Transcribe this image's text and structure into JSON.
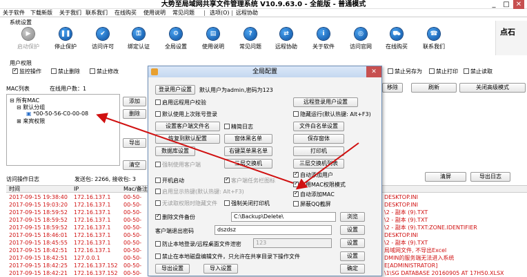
{
  "window": {
    "title": "大势至局域网共享文件管理系统 V10.9.63.0 - 全能版 - 普通模式",
    "controls": [
      "_",
      "□",
      "✕"
    ]
  },
  "menu": [
    "关于软件",
    "下载新版",
    "关于我们",
    "联系我们",
    "在线购买",
    "使用说明",
    "常见问题",
    "选项(O)",
    "远程协助"
  ],
  "sys_group": "系统设置",
  "toolbar": [
    {
      "label": "启动保护",
      "icon": "play-icon",
      "glyph": "▶",
      "disabled": true
    },
    {
      "label": "停止保护",
      "icon": "pause-icon",
      "glyph": "❚❚"
    },
    {
      "label": "访问许可",
      "icon": "access-icon",
      "glyph": "✔"
    },
    {
      "label": "绑定认证",
      "icon": "bind-icon",
      "glyph": "⚿"
    },
    {
      "label": "全局设置",
      "icon": "gear-icon",
      "glyph": "⚙"
    },
    {
      "label": "使用说明",
      "icon": "book-icon",
      "glyph": "▤"
    },
    {
      "label": "常见问题",
      "icon": "question-icon",
      "glyph": "?"
    },
    {
      "label": "远程协助",
      "icon": "remote-icon",
      "glyph": "⇄"
    },
    {
      "label": "关于软件",
      "icon": "info-icon",
      "glyph": "i"
    },
    {
      "label": "访问官网",
      "icon": "globe-icon",
      "glyph": "◎"
    },
    {
      "label": "在线购买",
      "icon": "cart-icon",
      "glyph": "⛟"
    },
    {
      "label": "联系我们",
      "icon": "contact-icon",
      "glyph": "☎"
    }
  ],
  "logo_text": "点石",
  "perm_group": "用户权限",
  "perms": [
    {
      "label": "监控操作",
      "checked": true
    },
    {
      "label": "禁止删除",
      "checked": false
    },
    {
      "label": "禁止修改",
      "checked": false
    },
    {
      "label": "禁止另存为",
      "checked": false
    },
    {
      "label": "禁止打印",
      "checked": false
    },
    {
      "label": "禁止读取",
      "checked": false
    }
  ],
  "mac_list_label": "MAC列表",
  "online_users": "在线用户数：1",
  "tree": {
    "root": "所有MAC",
    "group": "默认分组",
    "mac": "*00-50-56-C0-00-08",
    "extra": "来宾权限"
  },
  "left_buttons": [
    "添加",
    "删除",
    "导出",
    "清空"
  ],
  "right_buttons": [
    "移除",
    "刷新",
    "关闭高级模式"
  ],
  "log": {
    "title": "访问操作日志",
    "stats": "发送包: 2266, 接收包: 3",
    "clear": "清屏",
    "export": "导出日志",
    "headers": [
      "时间",
      "IP",
      "Mac/备注"
    ],
    "rows": [
      {
        "time": "2017-09-15 19:38:40",
        "ip": "172.16.137.1",
        "mac": "00-50-",
        "tail": "DESKTOP.INI"
      },
      {
        "time": "2017-09-15 19:03:20",
        "ip": "172.16.137.1",
        "mac": "00-50-",
        "tail": "DESKTOP.INI"
      },
      {
        "time": "2017-09-15 18:59:52",
        "ip": "172.16.137.1",
        "mac": "00-50-",
        "tail": "\\2 - 副本 (9).TXT"
      },
      {
        "time": "2017-09-15 18:59:52",
        "ip": "172.16.137.1",
        "mac": "00-50-",
        "tail": "\\2 - 副本 (9).TXT"
      },
      {
        "time": "2017-09-15 18:59:52",
        "ip": "172.16.137.1",
        "mac": "00-50-",
        "tail": "\\2 - 副本 (9).TXT:ZONE.IDENTIFIER"
      },
      {
        "time": "2017-09-15 18:46:01",
        "ip": "172.16.137.1",
        "mac": "00-50-",
        "tail": "DESKTOP.INI"
      },
      {
        "time": "2017-09-15 18:45:55",
        "ip": "172.16.137.1",
        "mac": "00-50-",
        "tail": "\\2 - 副本 (9).TXT"
      },
      {
        "time": "2017-09-15 18:42:51",
        "ip": "172.16.137.1",
        "mac": "00-50-",
        "tail": "局域网文件, 不导出Excel"
      },
      {
        "time": "2017-09-15 18:42:51",
        "ip": "127.0.0.1",
        "mac": "00-50-",
        "tail": "DMIN的服务端无法进入系统"
      },
      {
        "time": "2017-09-15 18:42:25",
        "ip": "172.16.137.152",
        "mac": "00-50-",
        "tail": "E[ADMINISTRATOR]"
      },
      {
        "time": "2017-09-15 18:42:21",
        "ip": "172.16.137.152",
        "mac": "00-50-",
        "tail": "\\1\\SG DATABASE 20160905 AT 17H50.XLSX"
      }
    ]
  },
  "dialog": {
    "title": "全局配置",
    "login_btn": "登录用户设置",
    "login_info": "默认用户为admin,密码为123",
    "remote_login_btn": "远程登录用户设置",
    "remote_verify": "启用远程用户校验",
    "hide_run": "隐藏运行(默认热键: Alt+F3)",
    "default_user": "默认使用上次账号登录",
    "client_file": "设置客户端文件名",
    "precise_log": "精简日志",
    "file_whitelist": "文件白名单设置",
    "restore_default": "恢复到默认配置",
    "window_blacklist": "窗体黑名单",
    "save_window": "保存窗体",
    "database_settings": "数据库设置",
    "right_menu_blacklist": "右键菜单黑名单",
    "printer": "打印机",
    "force_client": "强制使用客户端",
    "l3_switch": "三层交换机",
    "l3_switch_list": "三层交换机列表",
    "auto_add_user": "自动添加用户",
    "enable_mac_perm": "启用MAC权限模式",
    "auto_add_mac": "自动添加MAC",
    "block_qq": "屏蔽QQ截屏",
    "boot_start": "开机启动",
    "client_tray": "客户端任务栏图标",
    "enable_hotkey": "启用显示热键(默认热键: Alt+F3)",
    "no_perm_hide": "无读取权限时隐藏文件",
    "force_close_printer": "强制关闭打印机",
    "delete_backup": "删除文件备份",
    "backup_path": "C:\\Backup\\Delete\\",
    "browse": "浏览",
    "client_exit_pwd": "客户端退出密码",
    "client_pwd_value": "dszdsz",
    "set1": "设置",
    "prevent_login": "防止本地登录/远程桌面文件泄密",
    "prevent_value": "123",
    "set2": "设置",
    "forbid_local_edit": "禁止在本地磁盘编辑文件，只允许在共享目录下操作文件",
    "set3": "设置",
    "export_settings": "导出设置",
    "import_settings": "导入设置",
    "ok": "确定"
  }
}
